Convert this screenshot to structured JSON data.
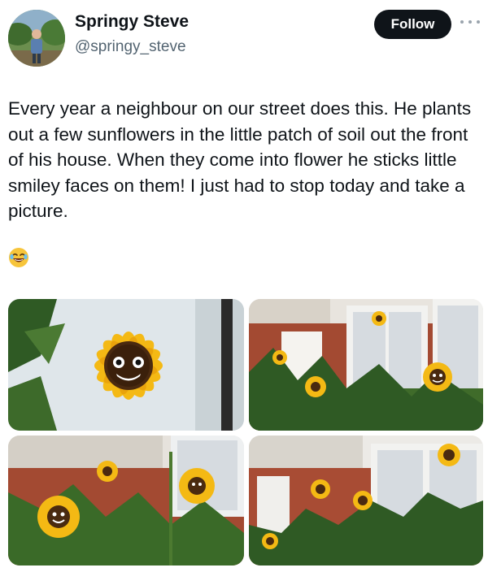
{
  "author": {
    "display_name": "Springy Steve",
    "handle": "@springy_steve",
    "follow_label": "Follow"
  },
  "tweet": {
    "text": "Every year a neighbour on our street does this. He plants out a few sunflowers in the little patch of soil out the front of his house. When they come into flower he sticks little smiley faces on them! I just had to stop today and take a picture.",
    "emoji": "face-with-tears-of-joy"
  },
  "media": {
    "photo_count": 4
  },
  "icons": {
    "more": "more-horizontal-icon"
  },
  "colors": {
    "text": "#0f1419",
    "secondary_text": "#536471",
    "follow_button_bg": "#0f1419",
    "follow_button_text": "#ffffff",
    "sunflower_petal": "#f4b914",
    "sunflower_center": "#4a2a10"
  }
}
